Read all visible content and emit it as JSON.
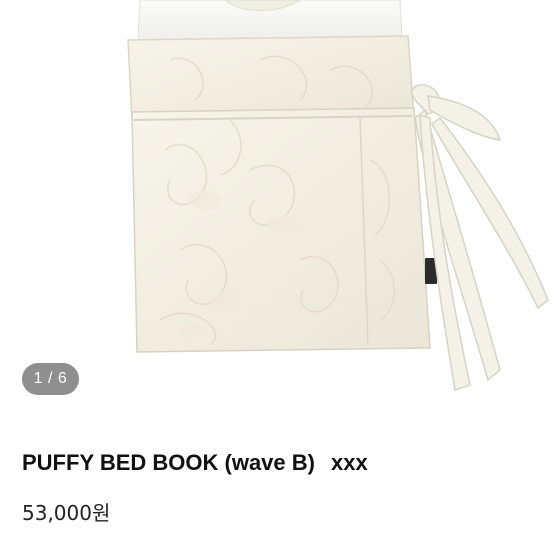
{
  "gallery": {
    "current_page": "1",
    "total_pages": "6",
    "indicator_text": "1 / 6"
  },
  "product": {
    "title": "PUFFY BED BOOK (wave B)",
    "brand_tag": "xxx",
    "price": "53,000원"
  },
  "colors": {
    "indicator_bg": "#8f8f8f",
    "fabric": "#f3efe4",
    "text": "#111111"
  }
}
